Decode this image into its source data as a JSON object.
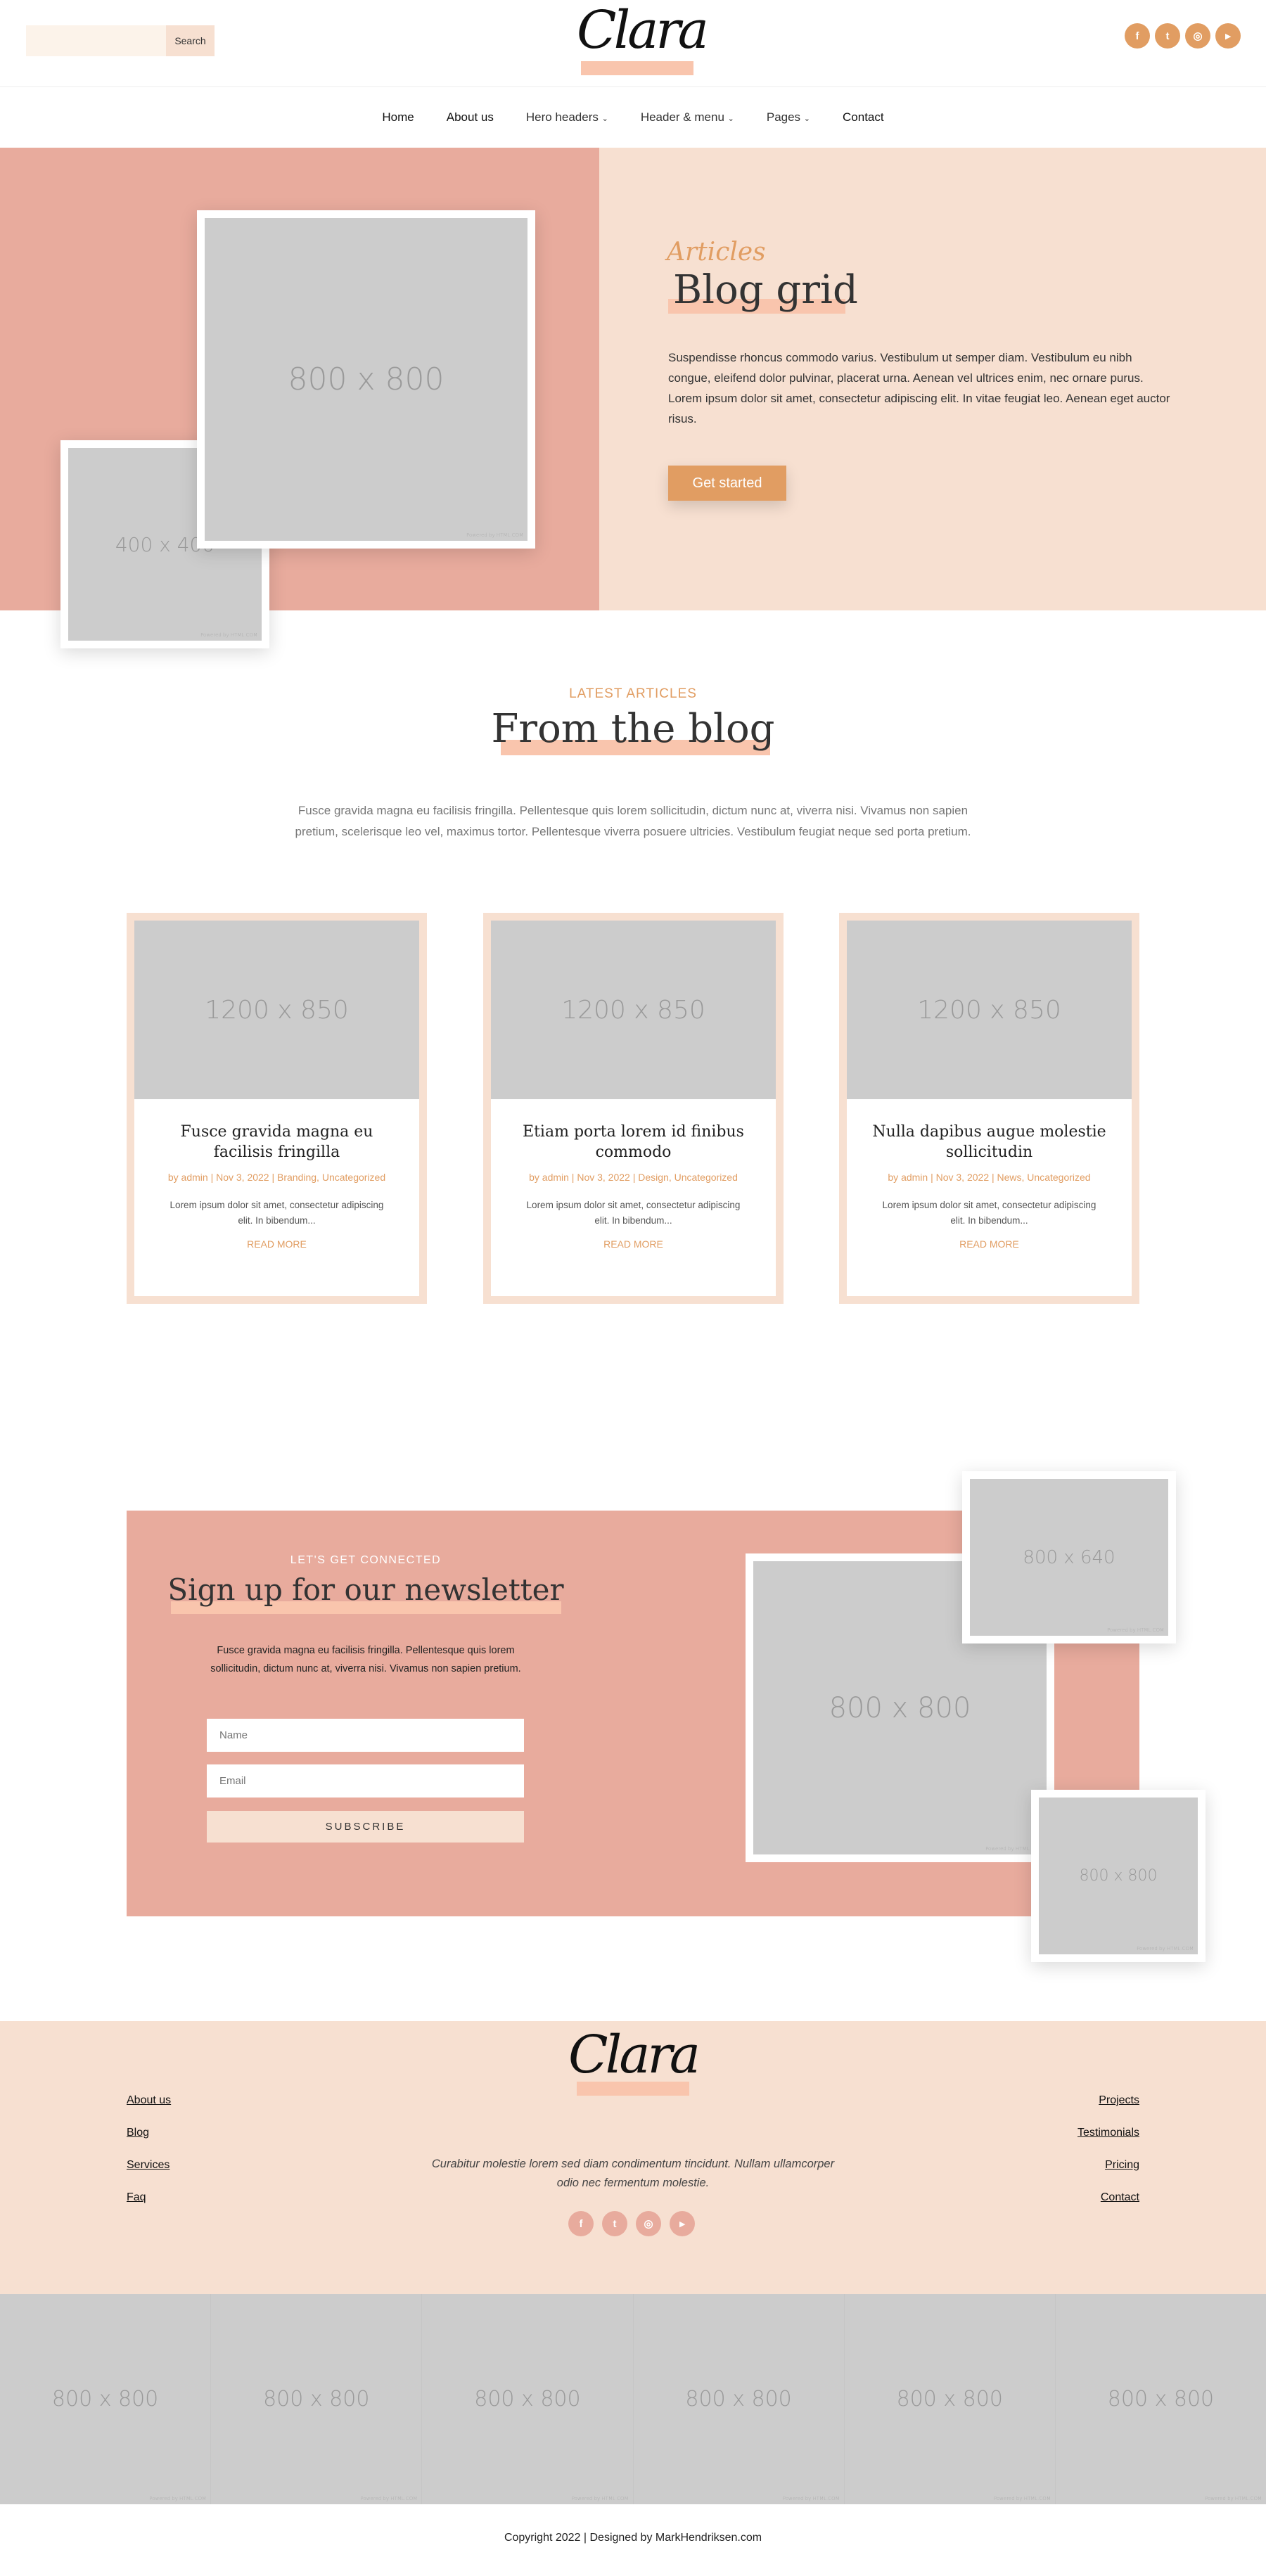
{
  "header": {
    "search_placeholder": "",
    "search_button": "Search",
    "logo": "Clara",
    "social": [
      "facebook-icon",
      "twitter-icon",
      "instagram-icon",
      "youtube-icon"
    ]
  },
  "nav": [
    {
      "label": "Home"
    },
    {
      "label": "About us"
    },
    {
      "label": "Hero headers",
      "dropdown": true
    },
    {
      "label": "Header & menu",
      "dropdown": true
    },
    {
      "label": "Pages",
      "dropdown": true
    },
    {
      "label": "Contact"
    }
  ],
  "hero": {
    "img_large": "800 x 800",
    "img_small": "400 x 400",
    "watermark": "Powered by HTML.COM",
    "eyebrow": "Articles",
    "title": "Blog grid",
    "text": "Suspendisse rhoncus commodo varius. Vestibulum ut semper diam. Vestibulum eu nibh congue, eleifend dolor pulvinar, placerat urna. Aenean vel ultrices enim, nec ornare purus. Lorem ipsum dolor sit amet, consectetur adipiscing elit. In vitae feugiat leo. Aenean eget auctor risus.",
    "button": "Get started"
  },
  "blog": {
    "eyebrow": "LATEST ARTICLES",
    "title": "From the blog",
    "intro": "Fusce gravida magna eu facilisis fringilla. Pellentesque quis lorem sollicitudin, dictum nunc at, viverra nisi. Vivamus non sapien pretium, scelerisque leo vel, maximus tortor. Pellentesque viverra posuere ultricies. Vestibulum feugiat neque sed porta pretium.",
    "posts": [
      {
        "image": "1200 x 850",
        "title": "Fusce gravida magna eu facilisis fringilla",
        "meta": "by admin | Nov 3, 2022 | Branding, Uncategorized",
        "excerpt": "Lorem ipsum dolor sit amet, consectetur adipiscing elit. In bibendum...",
        "read_more": "READ MORE"
      },
      {
        "image": "1200 x 850",
        "title": "Etiam porta lorem id finibus commodo",
        "meta": "by admin | Nov 3, 2022 | Design, Uncategorized",
        "excerpt": "Lorem ipsum dolor sit amet, consectetur adipiscing elit. In bibendum...",
        "read_more": "READ MORE"
      },
      {
        "image": "1200 x 850",
        "title": "Nulla dapibus augue molestie sollicitudin",
        "meta": "by admin | Nov 3, 2022 | News, Uncategorized",
        "excerpt": "Lorem ipsum dolor sit amet, consectetur adipiscing elit. In bibendum...",
        "read_more": "READ MORE"
      }
    ]
  },
  "newsletter": {
    "eyebrow": "LET'S GET CONNECTED",
    "title": "Sign up for our newsletter",
    "text": "Fusce gravida magna eu facilisis fringilla. Pellentesque quis lorem sollicitudin, dictum nunc at, viverra nisi. Vivamus non sapien pretium.",
    "name_placeholder": "Name",
    "email_placeholder": "Email",
    "button": "SUBSCRIBE",
    "img_a": "800 x 640",
    "img_b": "800 x 800",
    "img_c": "800 x 800"
  },
  "footer": {
    "left_links": [
      "About us",
      "Blog",
      "Services",
      "Faq"
    ],
    "right_links": [
      "Projects",
      "Testimonials",
      "Pricing",
      "Contact"
    ],
    "logo": "Clara",
    "tagline": "Curabitur molestie lorem sed diam condimentum tincidunt. Nullam ullamcorper odio nec fermentum molestie.",
    "social": [
      "facebook-icon",
      "twitter-icon",
      "instagram-icon",
      "youtube-icon"
    ]
  },
  "gallery": [
    "800 x 800",
    "800 x 800",
    "800 x 800",
    "800 x 800",
    "800 x 800",
    "800 x 800"
  ],
  "copyright": "Copyright 2022 | Designed by MarkHendriksen.com",
  "colors": {
    "pink": "#e8ab9d",
    "peach": "#f7e0d1",
    "accent": "#e19d62",
    "highlight": "#f9c5ad",
    "placeholder": "#cccccc"
  }
}
